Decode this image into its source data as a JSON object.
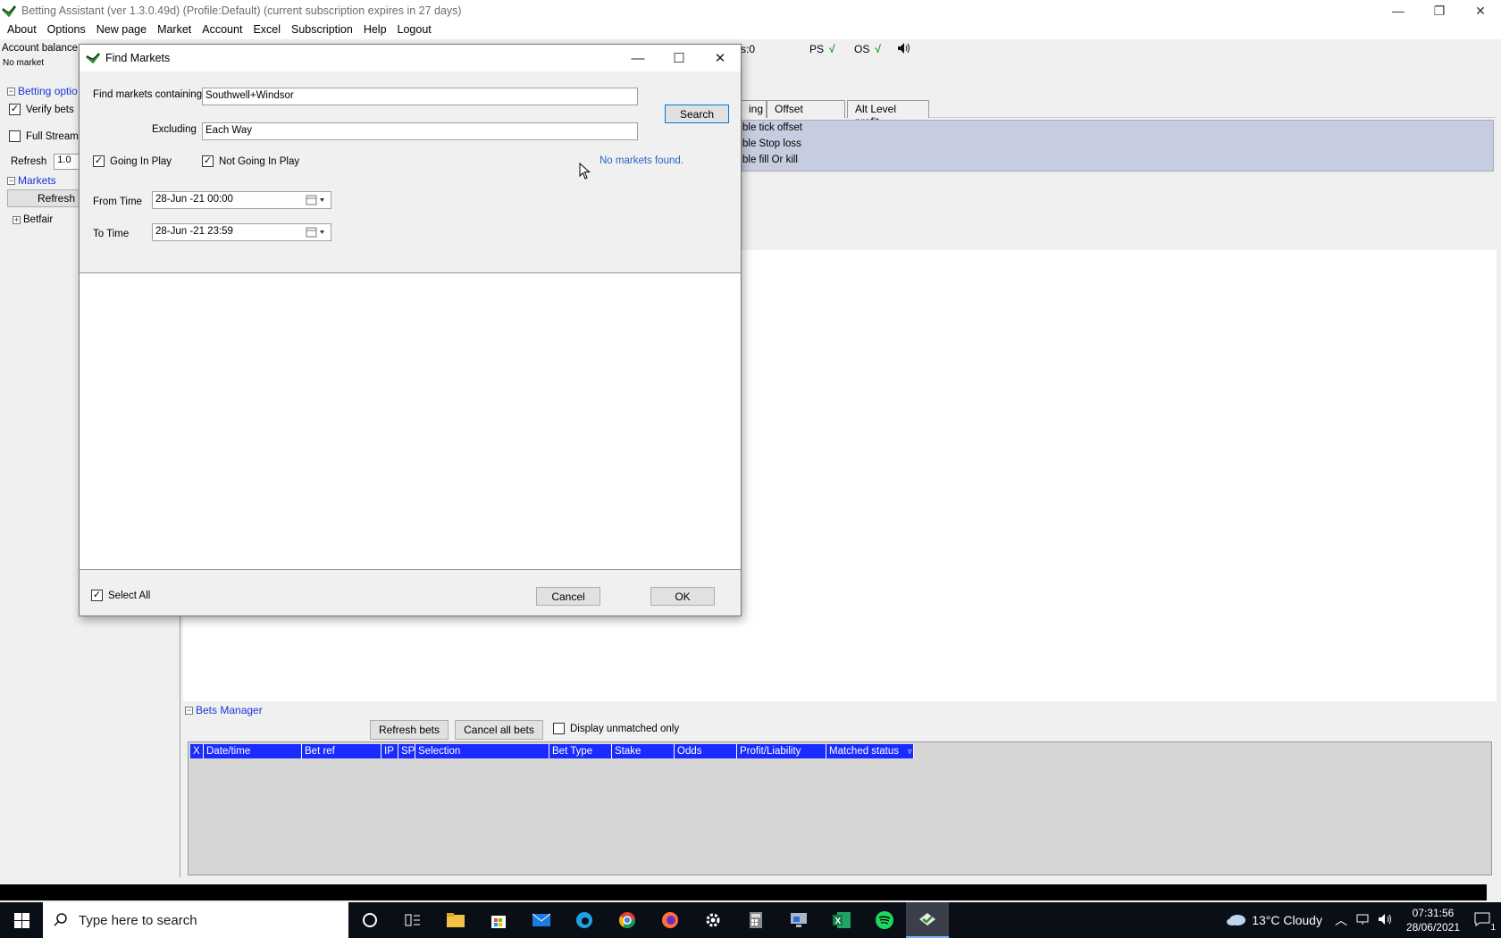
{
  "window": {
    "title": "Betting Assistant (ver 1.3.0.49d)    (Profile:Default)    (current subscription expires in 27 days)",
    "controls": [
      "—",
      "❐",
      "✕"
    ]
  },
  "menu": [
    "About",
    "Options",
    "New page",
    "Market",
    "Account",
    "Excel",
    "Subscription",
    "Help",
    "Logout"
  ],
  "status": {
    "account_balance": "Account balance:",
    "truncated": "s:0",
    "ps": "PS",
    "os": "OS",
    "check": "√",
    "no_market": "No market"
  },
  "left_panel": {
    "betting_options": "Betting optio",
    "verify_bets": "Verify bets",
    "full_stream": "Full Stream",
    "refresh_label": "Refresh",
    "refresh_value": "1.0",
    "markets": "Markets",
    "refresh_button": "Refresh",
    "betfair": "Betfair"
  },
  "tabs": [
    "ing",
    "Offset",
    "Alt Level profit"
  ],
  "options_list": [
    "ble tick offset",
    "ble Stop loss",
    "ble fill Or kill"
  ],
  "bets_manager": {
    "title": "Bets Manager",
    "refresh_bets": "Refresh bets",
    "cancel_all_bets": "Cancel all bets",
    "display_unmatched_only": "Display unmatched only",
    "columns": [
      "X",
      "Date/time",
      "Bet ref",
      "IP",
      "SP",
      "Selection",
      "Bet Type",
      "Stake",
      "Odds",
      "Profit/Liability",
      "Matched status"
    ]
  },
  "dialog": {
    "title": "Find Markets",
    "find_label": "Find markets containing",
    "find_value": "Southwell+Windsor",
    "excluding_label": "Excluding",
    "excluding_value": "Each Way",
    "search_button": "Search",
    "going_in_play": "Going In Play",
    "not_going_in_play": "Not Going In Play",
    "no_markets": "No markets found.",
    "from_time_label": "From Time",
    "from_time_value": "28-Jun -21 00:00",
    "to_time_label": "To Time",
    "to_time_value": "28-Jun -21 23:59",
    "select_all": "Select All",
    "cancel": "Cancel",
    "ok": "OK"
  },
  "taskbar": {
    "search_placeholder": "Type here to search",
    "weather": "13°C  Cloudy",
    "time": "07:31:56",
    "date": "28/06/2021",
    "notifications": "1"
  },
  "colors": {
    "link_blue": "#1a35d8",
    "header_blue": "#1a2bff",
    "options_bg": "#c7cde0",
    "check_green": "#19a019"
  }
}
